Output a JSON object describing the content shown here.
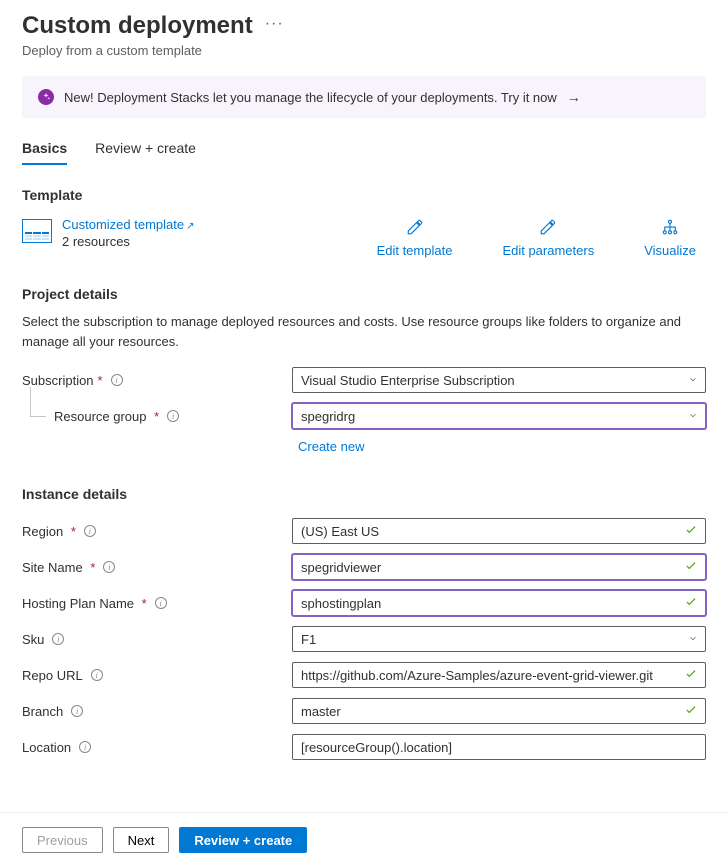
{
  "header": {
    "title": "Custom deployment",
    "subtitle": "Deploy from a custom template"
  },
  "banner": {
    "text": "New! Deployment Stacks let you manage the lifecycle of your deployments. Try it now"
  },
  "tabs": [
    {
      "label": "Basics",
      "active": true
    },
    {
      "label": "Review + create",
      "active": false
    }
  ],
  "template": {
    "heading": "Template",
    "link_label": "Customized template",
    "resources_label": "2 resources",
    "actions": {
      "edit_template": "Edit template",
      "edit_parameters": "Edit parameters",
      "visualize": "Visualize"
    }
  },
  "project": {
    "heading": "Project details",
    "description": "Select the subscription to manage deployed resources and costs. Use resource groups like folders to organize and manage all your resources.",
    "subscription_label": "Subscription",
    "subscription_value": "Visual Studio Enterprise Subscription",
    "resource_group_label": "Resource group",
    "resource_group_value": "spegridrg",
    "create_new_label": "Create new"
  },
  "instance": {
    "heading": "Instance details",
    "fields": {
      "region": {
        "label": "Region",
        "value": "(US) East US",
        "required": true,
        "type": "select-check"
      },
      "site_name": {
        "label": "Site Name",
        "value": "spegridviewer",
        "required": true,
        "type": "text-check",
        "highlight": true
      },
      "hosting_plan": {
        "label": "Hosting Plan Name",
        "value": "sphostingplan",
        "required": true,
        "type": "text-check",
        "highlight": true
      },
      "sku": {
        "label": "Sku",
        "value": "F1",
        "required": false,
        "type": "select"
      },
      "repo_url": {
        "label": "Repo URL",
        "value": "https://github.com/Azure-Samples/azure-event-grid-viewer.git",
        "required": false,
        "type": "text-check"
      },
      "branch": {
        "label": "Branch",
        "value": "master",
        "required": false,
        "type": "text-check"
      },
      "location": {
        "label": "Location",
        "value": "[resourceGroup().location]",
        "required": false,
        "type": "text"
      }
    }
  },
  "footer": {
    "previous": "Previous",
    "next": "Next",
    "review_create": "Review + create"
  }
}
